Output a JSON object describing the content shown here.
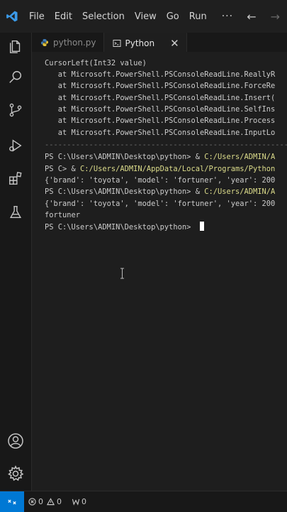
{
  "menu": {
    "items": [
      "File",
      "Edit",
      "Selection",
      "View",
      "Go",
      "Run"
    ],
    "more": "···"
  },
  "tabs": [
    {
      "label": "python.py",
      "active": false
    },
    {
      "label": "Python",
      "active": true,
      "close": "✕"
    }
  ],
  "terminal": {
    "lines": [
      {
        "segments": [
          {
            "text": "CursorLeft(Int32 value)"
          }
        ]
      },
      {
        "segments": [
          {
            "text": "   at Microsoft.PowerShell.PSConsoleReadLine.ReallyR"
          }
        ]
      },
      {
        "segments": [
          {
            "text": "   at Microsoft.PowerShell.PSConsoleReadLine.ForceRe"
          }
        ]
      },
      {
        "segments": [
          {
            "text": "   at Microsoft.PowerShell.PSConsoleReadLine.Insert("
          }
        ]
      },
      {
        "segments": [
          {
            "text": "   at Microsoft.PowerShell.PSConsoleReadLine.SelfIns"
          }
        ]
      },
      {
        "segments": [
          {
            "text": "   at Microsoft.PowerShell.PSConsoleReadLine.Process"
          }
        ]
      },
      {
        "segments": [
          {
            "text": "   at Microsoft.PowerShell.PSConsoleReadLine.InputLo"
          }
        ]
      },
      {
        "segments": [
          {
            "text": "-------------------------------------------------------"
          }
        ]
      },
      {
        "segments": [
          {
            "text": "PS C:\\Users\\ADMIN\\Desktop\\python> & "
          },
          {
            "text": "C:/Users/ADMIN/A",
            "yellow": true
          }
        ]
      },
      {
        "segments": [
          {
            "text": "PS C> & "
          },
          {
            "text": "C:/Users/ADMIN/AppData/Local/Programs/Python",
            "yellow": true
          }
        ]
      },
      {
        "segments": [
          {
            "text": "{'brand': 'toyota', 'model': 'fortuner', 'year': 200"
          }
        ]
      },
      {
        "segments": [
          {
            "text": "PS C:\\Users\\ADMIN\\Desktop\\python> & "
          },
          {
            "text": "C:/Users/ADMIN/A",
            "yellow": true
          }
        ]
      },
      {
        "segments": [
          {
            "text": "{'brand': 'toyota', 'model': 'fortuner', 'year': 200"
          }
        ]
      },
      {
        "segments": [
          {
            "text": "fortuner"
          }
        ]
      },
      {
        "segments": [
          {
            "text": "PS C:\\Users\\ADMIN\\Desktop\\python> "
          }
        ],
        "cursor": true
      }
    ]
  },
  "statusbar": {
    "errors": "0",
    "warnings": "0",
    "ports": "0"
  },
  "colors": {
    "accent": "#0078d4",
    "path_highlight": "#dcdc8b",
    "background": "#1e1e1e"
  }
}
